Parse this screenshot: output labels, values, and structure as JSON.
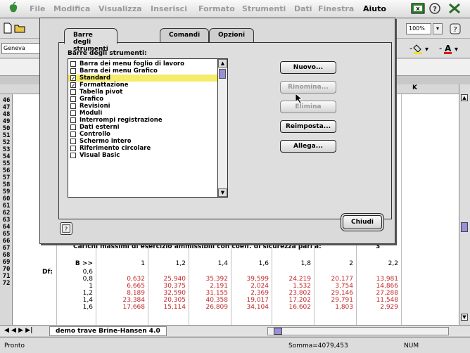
{
  "menubar": {
    "items": [
      "File",
      "Modifica",
      "Visualizza",
      "Inserisci",
      "Formato",
      "Strumenti",
      "Dati",
      "Finestra",
      "Aiuto"
    ]
  },
  "toolbar": {
    "zoom": "100%",
    "font": "Geneva"
  },
  "sheet": {
    "column_header_label": "K",
    "row_numbers": [
      "46",
      "47",
      "48",
      "49",
      "50",
      "51",
      "52",
      "53",
      "54",
      "55",
      "56",
      "57",
      "58",
      "59",
      "60",
      "61",
      "62",
      "63",
      "64",
      "65",
      "66",
      "67",
      "68",
      "69",
      "70",
      "71",
      "72"
    ],
    "title": "Carichi massimi di esercizio ammissibili con coeff. di sicurezza pari a:",
    "safety_factor": "3",
    "header_b": "B >>",
    "col_values": [
      "1",
      "1,2",
      "1,4",
      "1,6",
      "1,8",
      "2",
      "2,2"
    ],
    "df_label": "Df:",
    "rows": [
      {
        "df": "0,6",
        "vals": [
          "",
          "",
          "",
          "",
          "",
          "",
          ""
        ]
      },
      {
        "df": "0,8",
        "vals": [
          "0,632",
          "25,940",
          "35,392",
          "39,599",
          "24,219",
          "20,177",
          "13,981"
        ]
      },
      {
        "df": "1",
        "vals": [
          "6,665",
          "30,375",
          "2,191",
          "2,024",
          "1,532",
          "3,754",
          "14,866"
        ]
      },
      {
        "df": "1,2",
        "vals": [
          "8,189",
          "32,590",
          "31,155",
          "2,369",
          "23,802",
          "29,146",
          "27,288"
        ]
      },
      {
        "df": "1,4",
        "vals": [
          "23,384",
          "20,305",
          "40,358",
          "19,017",
          "17,202",
          "29,791",
          "11,548"
        ]
      },
      {
        "df": "1,6",
        "vals": [
          "17,668",
          "15,114",
          "26,809",
          "34,104",
          "16,602",
          "1,803",
          "2,929"
        ]
      }
    ],
    "tab_name": "demo trave Brine-Hansen 4.0",
    "tab_nav": "◀ ◀ ▶ ▶|"
  },
  "status": {
    "left": "Pronto",
    "sum": "Somma=4079,453",
    "mode": "NUM"
  },
  "dialog": {
    "tabs": [
      "Barre degli strumenti",
      "Comandi",
      "Opzioni"
    ],
    "list_label": "Barre degli strumenti:",
    "items": [
      {
        "label": "Barra dei menu foglio di lavoro",
        "checked": false
      },
      {
        "label": "Barra dei menu Grafico",
        "checked": false
      },
      {
        "label": "Standard",
        "checked": true,
        "selected": true
      },
      {
        "label": "Formattazione",
        "checked": true
      },
      {
        "label": "Tabella pivot",
        "checked": false
      },
      {
        "label": "Grafico",
        "checked": false
      },
      {
        "label": "Revisioni",
        "checked": false
      },
      {
        "label": "Moduli",
        "checked": false
      },
      {
        "label": "Interrompi registrazione",
        "checked": false
      },
      {
        "label": "Dati esterni",
        "checked": false
      },
      {
        "label": "Controllo",
        "checked": false
      },
      {
        "label": "Schermo intero",
        "checked": false
      },
      {
        "label": "Riferimento circolare",
        "checked": false
      },
      {
        "label": "Visual Basic",
        "checked": false
      }
    ],
    "buttons": {
      "new": "Nuovo...",
      "rename": "Rinomina...",
      "delete": "Elimina",
      "reset": "Reimposta...",
      "attach": "Allega...",
      "close": "Chiudi"
    }
  }
}
